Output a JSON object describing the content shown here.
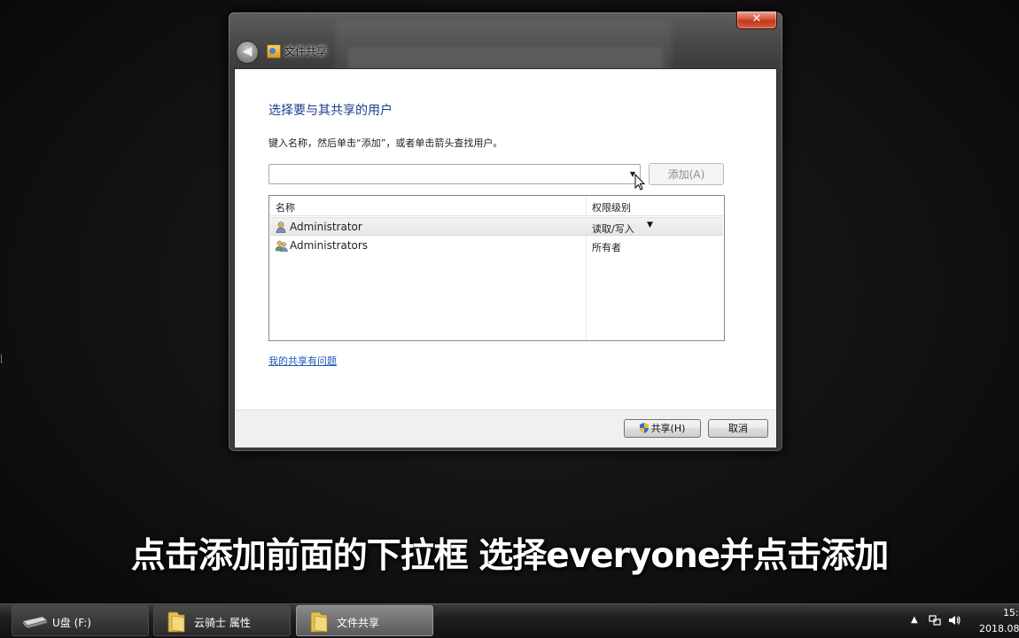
{
  "window": {
    "title": "文件共享",
    "close_label": "✕",
    "back_label": "◀"
  },
  "dialog": {
    "heading": "选择要与其共享的用户",
    "instruction": "键入名称，然后单击“添加”，或者单击箭头查找用户。",
    "combo_value": "",
    "add_button": "添加(A)",
    "columns": {
      "name": "名称",
      "permission": "权限级别"
    },
    "rows": [
      {
        "name": "Administrator",
        "permission": "读取/写入",
        "icon": "user-icon",
        "selected": true
      },
      {
        "name": "Administrators",
        "permission": "所有者",
        "icon": "users-group-icon",
        "selected": false
      }
    ],
    "help_link": "我的共享有问题",
    "share_button": "共享(H)",
    "cancel_button": "取消"
  },
  "subtitle": "点击添加前面的下拉框 选择everyone并点击添加",
  "taskbar": {
    "items": [
      {
        "label": "U盘 (F:)",
        "icon": "usb-drive-icon",
        "active": false
      },
      {
        "label": "云骑士 属性",
        "icon": "folder-icon",
        "active": false
      },
      {
        "label": "文件共享",
        "icon": "folder-icon",
        "active": true
      }
    ],
    "tray": {
      "arrow": "▲",
      "time": "15:",
      "date": "2018.08"
    }
  },
  "colors": {
    "heading": "#1e3f8f",
    "link": "#1a5ab8",
    "close": "#c3371c"
  }
}
